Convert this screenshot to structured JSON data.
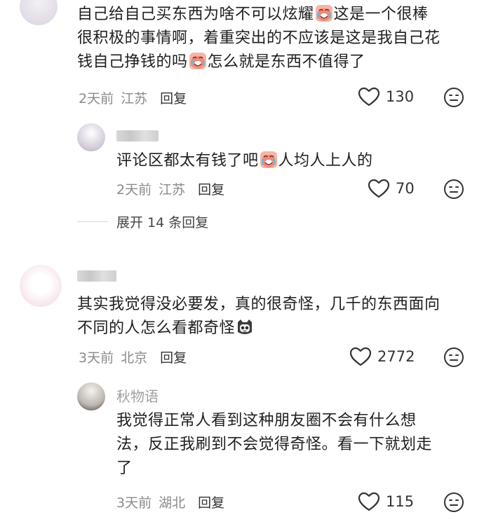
{
  "comments": [
    {
      "line1a": "自己给自己买东西为啥不可以炫耀",
      "line1b": "这是一个很棒",
      "line2": "很积极的事情啊，着重突出的不应该是这是我自己花",
      "line3a": "钱自己挣钱的吗",
      "line3b": "怎么就是东西不值得了",
      "time": "2天前",
      "location": "江苏",
      "reply": "回复",
      "likes": "130",
      "emoji": "crying-face",
      "reply_comment": {
        "text_a": "评论区都太有钱了吧",
        "text_b": "人均人上人的",
        "time": "2天前",
        "location": "江苏",
        "reply": "回复",
        "likes": "70"
      },
      "expand_label": "展开 14 条回复"
    },
    {
      "line1": "其实我觉得没必要发，真的很奇怪，几千的东西面向",
      "line2": "不同的人怎么看都奇怪",
      "time": "3天前",
      "location": "北京",
      "reply": "回复",
      "likes": "2772",
      "emoji": "cat-face",
      "reply_comment": {
        "username": "秋物语",
        "line1": "我觉得正常人看到这种朋友圈不会有什么想",
        "line2": "法，反正我刷到不会觉得奇怪。看一下就划走",
        "line3": "了",
        "time": "3天前",
        "location": "湖北",
        "reply": "回复",
        "likes": "115"
      }
    }
  ],
  "colors": {
    "meta": "#8a8a8a",
    "text": "#1e1e1e",
    "emoji_bg": "#f4a58a"
  }
}
